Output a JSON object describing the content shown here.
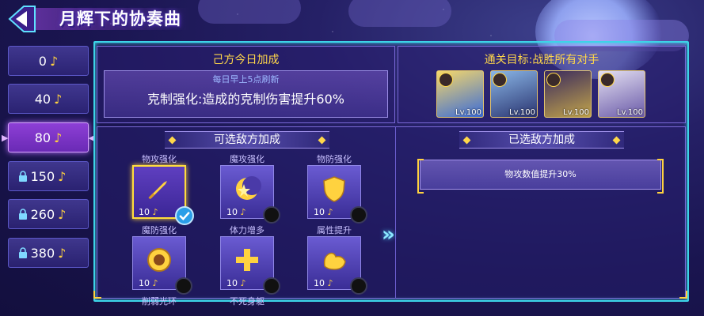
{
  "title": "月辉下的协奏曲",
  "tiers": [
    {
      "value": "0",
      "note": "♪",
      "locked": false,
      "active": false
    },
    {
      "value": "40",
      "note": "♪",
      "locked": false,
      "active": false
    },
    {
      "value": "80",
      "note": "♪",
      "locked": false,
      "active": true
    },
    {
      "value": "150",
      "note": "♪",
      "locked": true,
      "active": false
    },
    {
      "value": "260",
      "note": "♪",
      "locked": true,
      "active": false
    },
    {
      "value": "380",
      "note": "♪",
      "locked": true,
      "active": false
    }
  ],
  "ally_panel": {
    "heading": "己方今日加成",
    "refresh_note": "每日早上5点刷新",
    "bonus": "克制强化:造成的克制伤害提升60%"
  },
  "objective_panel": {
    "heading": "通关目标:战胜所有对手",
    "enemies": [
      {
        "level": "Lv.100"
      },
      {
        "level": "Lv.100"
      },
      {
        "level": "Lv.100"
      },
      {
        "level": "Lv.100"
      }
    ]
  },
  "optional_buffs": {
    "heading": "可选敌方加成",
    "items": [
      {
        "name": "物攻强化",
        "cost": "10",
        "note": "♪",
        "selected": true,
        "icon": "sword-icon"
      },
      {
        "name": "魔攻强化",
        "cost": "10",
        "note": "♪",
        "selected": false,
        "icon": "moon-star-icon"
      },
      {
        "name": "物防强化",
        "cost": "10",
        "note": "♪",
        "selected": false,
        "icon": "shield-icon"
      },
      {
        "name": "魔防强化",
        "cost": "10",
        "note": "♪",
        "selected": false,
        "icon": "emblem-icon"
      },
      {
        "name": "体力增多",
        "cost": "10",
        "note": "♪",
        "selected": false,
        "icon": "plus-icon"
      },
      {
        "name": "属性提升",
        "cost": "10",
        "note": "♪",
        "selected": false,
        "icon": "muscle-icon"
      }
    ],
    "bottom_labels": [
      "削弱光环",
      "不死身躯"
    ]
  },
  "selected_buffs": {
    "heading": "已选敌方加成",
    "items": [
      "物攻数值提升30%"
    ]
  },
  "colors": {
    "accent_yellow": "#ffd74a",
    "frame_cyan": "#3dd4e8",
    "active_purple": "#8d3fd6"
  }
}
